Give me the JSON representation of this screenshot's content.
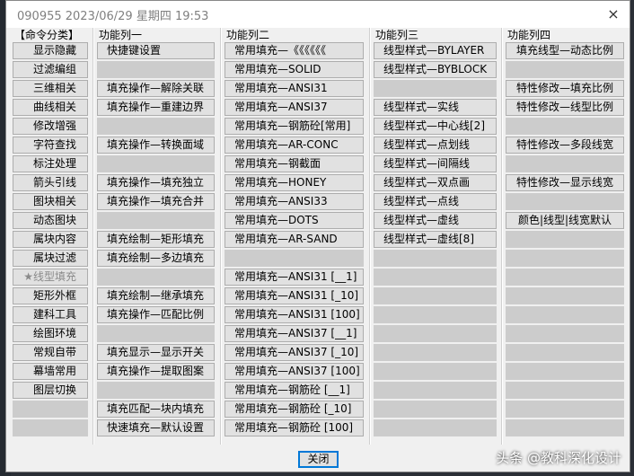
{
  "title": "090955 2023/06/29 星期四 19:53",
  "close_icon": "×",
  "columns": [
    {
      "header": "【命令分类】",
      "items": [
        "显示隐藏",
        "过滤编组",
        "三维相关",
        "曲线相关",
        "修改增强",
        "字符查找",
        "标注处理",
        "箭头引线",
        "图块相关",
        "动态图块",
        "属块内容",
        "属块过滤",
        "★线型填充",
        "矩形外框",
        "建科工具",
        "绘图环境",
        "常规自带",
        "幕墙常用",
        "图层切换",
        "",
        ""
      ],
      "disabled_index": 12
    },
    {
      "header": "功能列一",
      "items": [
        "快捷键设置",
        "",
        "填充操作—解除关联",
        "填充操作—重建边界",
        "",
        "填充操作—转换面域",
        "",
        "填充操作—填充独立",
        "填充操作—填充合并",
        "",
        "填充绘制—矩形填充",
        "填充绘制—多边填充",
        "",
        "填充绘制—继承填充",
        "填充操作—匹配比例",
        "",
        "填充显示—显示开关",
        "填充操作—提取图案",
        "",
        "填充匹配—块内填充",
        "快速填充—默认设置"
      ]
    },
    {
      "header": "功能列二",
      "items": [
        "常用填充—《《《《《《",
        "常用填充—SOLID",
        "常用填充—ANSI31",
        "常用填充—ANSI37",
        "常用填充—钢筋砼[常用]",
        "常用填充—AR-CONC",
        "常用填充—钢截面",
        "常用填充—HONEY",
        "常用填充—ANSI33",
        "常用填充—DOTS",
        "常用填充—AR-SAND",
        "",
        "常用填充—ANSI31 [__1]",
        "常用填充—ANSI31 [_10]",
        "常用填充—ANSI31 [100]",
        "常用填充—ANSI37 [__1]",
        "常用填充—ANSI37 [_10]",
        "常用填充—ANSI37 [100]",
        "常用填充—钢筋砼 [__1]",
        "常用填充—钢筋砼 [_10]",
        "常用填充—钢筋砼 [100]"
      ]
    },
    {
      "header": "功能列三",
      "items": [
        "线型样式—BYLAYER",
        "线型样式—BYBLOCK",
        "",
        "线型样式—实线",
        "线型样式—中心线[2]",
        "线型样式—点划线",
        "线型样式—间隔线",
        "线型样式—双点画",
        "线型样式—点线",
        "线型样式—虚线",
        "线型样式—虚线[8]",
        "",
        "",
        "",
        "",
        "",
        "",
        "",
        "",
        "",
        ""
      ]
    },
    {
      "header": "功能列四",
      "items": [
        "填充线型—动态比例",
        "",
        "特性修改—填充比例",
        "特性修改—线型比例",
        "",
        "特性修改—多段线宽",
        "",
        "特性修改—显示线宽",
        "",
        "颜色|线型|线宽默认",
        "",
        "",
        "",
        "",
        "",
        "",
        "",
        "",
        "",
        "",
        ""
      ]
    }
  ],
  "close_button": "关闭",
  "watermark": "头条 @教科深化设计"
}
